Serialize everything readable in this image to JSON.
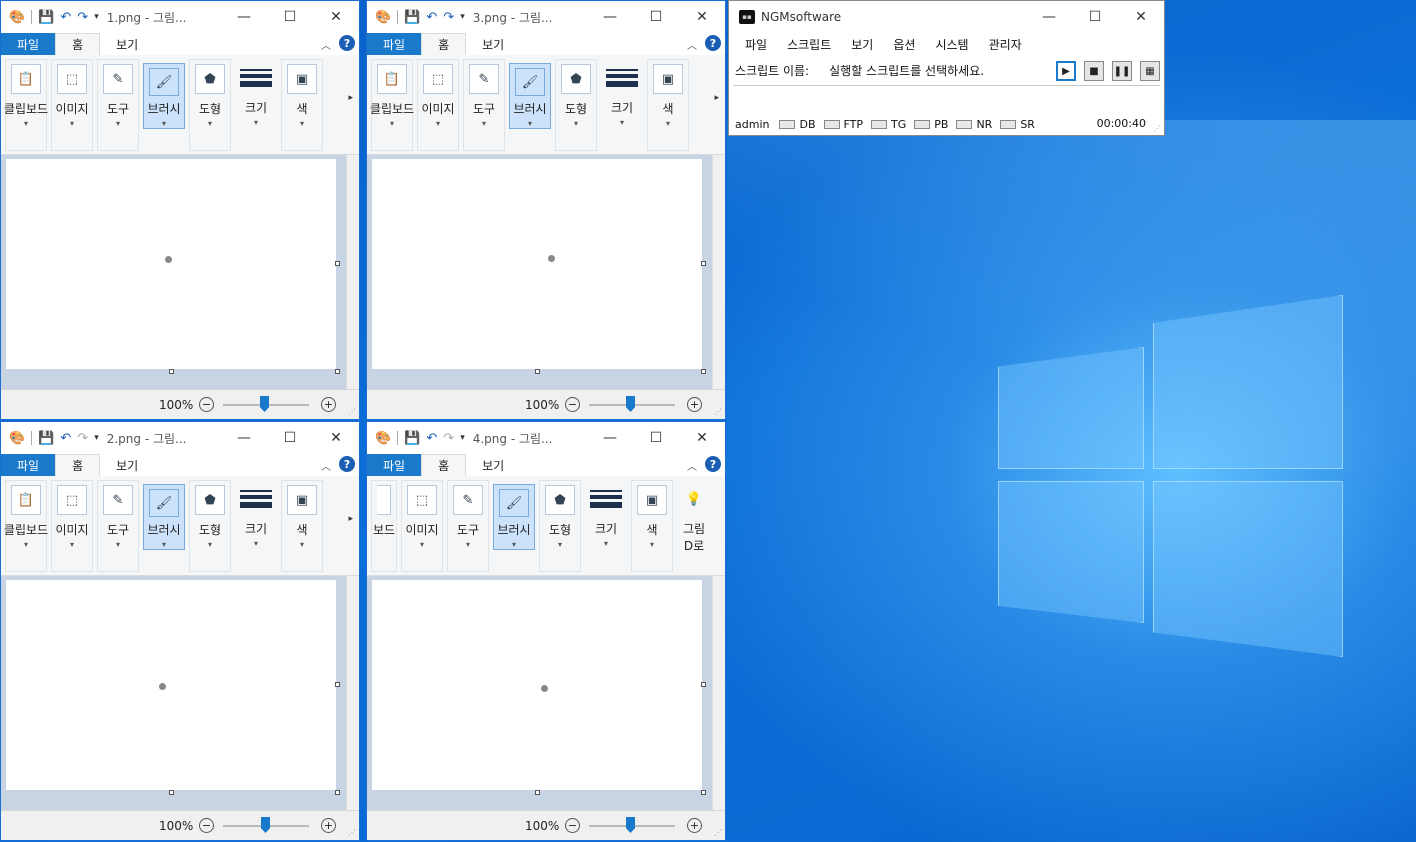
{
  "paint_common": {
    "tabs": {
      "file": "파일",
      "home": "홈",
      "view": "보기"
    },
    "help": "?",
    "groups": {
      "clipboard": "클립보드",
      "image": "이미지",
      "tools": "도구",
      "brush": "브러시",
      "shapes": "도형",
      "size": "크기",
      "color": "색",
      "paint3d": "그림",
      "paint3d_line2": "D로"
    },
    "group_partial": "보드",
    "zoom": "100%"
  },
  "windows": [
    {
      "title": "1.png - 그림..."
    },
    {
      "title": "3.png - 그림..."
    },
    {
      "title": "2.png - 그림..."
    },
    {
      "title": "4.png - 그림..."
    }
  ],
  "ngm": {
    "title": "NGMsoftware",
    "menu": [
      "파일",
      "스크립트",
      "보기",
      "옵션",
      "시스템",
      "관리자"
    ],
    "script_label": "스크립트 이름:",
    "script_value": "실행할 스크립트를 선택하세요.",
    "status": {
      "user": "admin",
      "indicators": [
        "DB",
        "FTP",
        "TG",
        "PB",
        "NR",
        "SR"
      ],
      "time": "00:00:40"
    }
  }
}
